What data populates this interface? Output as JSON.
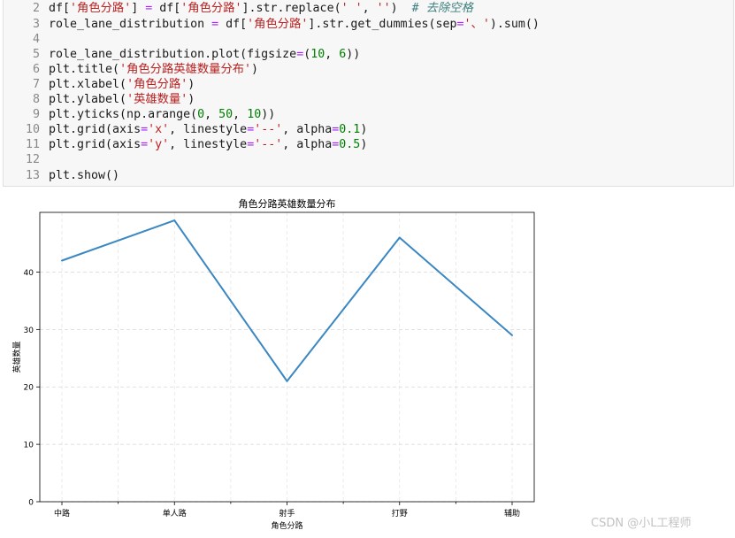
{
  "code_cell": {
    "lines": [
      {
        "num": "2",
        "tokens": [
          {
            "t": "df[",
            "k": "plain"
          },
          {
            "t": "'角色分路'",
            "k": "str"
          },
          {
            "t": "] ",
            "k": "plain"
          },
          {
            "t": "=",
            "k": "op"
          },
          {
            "t": " df[",
            "k": "plain"
          },
          {
            "t": "'角色分路'",
            "k": "str"
          },
          {
            "t": "].str.replace(",
            "k": "plain"
          },
          {
            "t": "' '",
            "k": "str"
          },
          {
            "t": ", ",
            "k": "plain"
          },
          {
            "t": "''",
            "k": "str"
          },
          {
            "t": ")  ",
            "k": "plain"
          },
          {
            "t": "# 去除空格",
            "k": "com"
          }
        ]
      },
      {
        "num": "3",
        "tokens": [
          {
            "t": "role_lane_distribution ",
            "k": "plain"
          },
          {
            "t": "=",
            "k": "op"
          },
          {
            "t": " df[",
            "k": "plain"
          },
          {
            "t": "'角色分路'",
            "k": "str"
          },
          {
            "t": "].str.get_dummies(sep",
            "k": "plain"
          },
          {
            "t": "=",
            "k": "op"
          },
          {
            "t": "'、'",
            "k": "str"
          },
          {
            "t": ").sum()",
            "k": "plain"
          }
        ]
      },
      {
        "num": "4",
        "tokens": []
      },
      {
        "num": "5",
        "tokens": [
          {
            "t": "role_lane_distribution.plot(figsize",
            "k": "plain"
          },
          {
            "t": "=",
            "k": "op"
          },
          {
            "t": "(",
            "k": "plain"
          },
          {
            "t": "10",
            "k": "num"
          },
          {
            "t": ", ",
            "k": "plain"
          },
          {
            "t": "6",
            "k": "num"
          },
          {
            "t": "))",
            "k": "plain"
          }
        ]
      },
      {
        "num": "6",
        "tokens": [
          {
            "t": "plt.title(",
            "k": "plain"
          },
          {
            "t": "'角色分路英雄数量分布'",
            "k": "str"
          },
          {
            "t": ")",
            "k": "plain"
          }
        ]
      },
      {
        "num": "7",
        "tokens": [
          {
            "t": "plt.xlabel(",
            "k": "plain"
          },
          {
            "t": "'角色分路'",
            "k": "str"
          },
          {
            "t": ")",
            "k": "plain"
          }
        ]
      },
      {
        "num": "8",
        "tokens": [
          {
            "t": "plt.ylabel(",
            "k": "plain"
          },
          {
            "t": "'英雄数量'",
            "k": "str"
          },
          {
            "t": ")",
            "k": "plain"
          }
        ]
      },
      {
        "num": "9",
        "tokens": [
          {
            "t": "plt.yticks(np.arange(",
            "k": "plain"
          },
          {
            "t": "0",
            "k": "num"
          },
          {
            "t": ", ",
            "k": "plain"
          },
          {
            "t": "50",
            "k": "num"
          },
          {
            "t": ", ",
            "k": "plain"
          },
          {
            "t": "10",
            "k": "num"
          },
          {
            "t": "))",
            "k": "plain"
          }
        ]
      },
      {
        "num": "10",
        "tokens": [
          {
            "t": "plt.grid(axis",
            "k": "plain"
          },
          {
            "t": "=",
            "k": "op"
          },
          {
            "t": "'x'",
            "k": "str"
          },
          {
            "t": ", linestyle",
            "k": "plain"
          },
          {
            "t": "=",
            "k": "op"
          },
          {
            "t": "'--'",
            "k": "str"
          },
          {
            "t": ", alpha",
            "k": "plain"
          },
          {
            "t": "=",
            "k": "op"
          },
          {
            "t": "0.1",
            "k": "num"
          },
          {
            "t": ")",
            "k": "plain"
          }
        ]
      },
      {
        "num": "11",
        "tokens": [
          {
            "t": "plt.grid(axis",
            "k": "plain"
          },
          {
            "t": "=",
            "k": "op"
          },
          {
            "t": "'y'",
            "k": "str"
          },
          {
            "t": ", linestyle",
            "k": "plain"
          },
          {
            "t": "=",
            "k": "op"
          },
          {
            "t": "'--'",
            "k": "str"
          },
          {
            "t": ", alpha",
            "k": "plain"
          },
          {
            "t": "=",
            "k": "op"
          },
          {
            "t": "0.5",
            "k": "num"
          },
          {
            "t": ")",
            "k": "plain"
          }
        ]
      },
      {
        "num": "12",
        "tokens": []
      },
      {
        "num": "13",
        "tokens": [
          {
            "t": "plt.show()",
            "k": "plain"
          }
        ]
      }
    ]
  },
  "chart_data": {
    "type": "line",
    "title": "角色分路英雄数量分布",
    "xlabel": "角色分路",
    "ylabel": "英雄数量",
    "categories": [
      "中路",
      "单人路",
      "射手",
      "打野",
      "辅助"
    ],
    "values": [
      42,
      49,
      21,
      46,
      29
    ],
    "yticks": [
      0,
      10,
      20,
      30,
      40
    ],
    "ylim": [
      0,
      50.4
    ],
    "grid": {
      "x": true,
      "y": true
    },
    "line_color": "#3a87c2"
  },
  "watermark": "CSDN @小L工程师"
}
